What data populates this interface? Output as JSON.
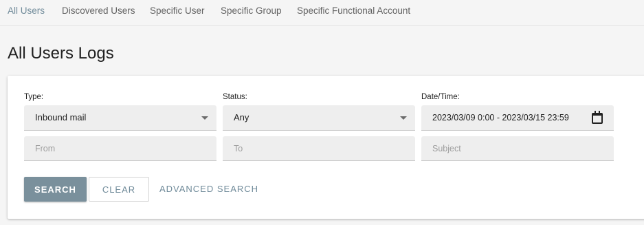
{
  "tabs": [
    {
      "label": "All Users",
      "active": true
    },
    {
      "label": "Discovered Users",
      "active": false
    },
    {
      "label": "Specific User",
      "active": false
    },
    {
      "label": "Specific Group",
      "active": false
    },
    {
      "label": "Specific Functional Account",
      "active": false
    }
  ],
  "page": {
    "title": "All Users Logs"
  },
  "filters": {
    "type": {
      "label": "Type:",
      "value": "Inbound mail"
    },
    "status": {
      "label": "Status:",
      "value": "Any"
    },
    "datetime": {
      "label": "Date/Time:",
      "value": "2023/03/09 0:00 - 2023/03/15 23:59",
      "icon": "calendar-icon"
    },
    "from": {
      "placeholder": "From"
    },
    "to": {
      "placeholder": "To"
    },
    "subject": {
      "placeholder": "Subject"
    }
  },
  "actions": {
    "search_label": "SEARCH",
    "clear_label": "CLEAR",
    "advanced_label": "ADVANCED SEARCH"
  },
  "colors": {
    "accent": "#6f8a99",
    "primary_button": "#7a909c",
    "background": "#f5f5f5"
  }
}
